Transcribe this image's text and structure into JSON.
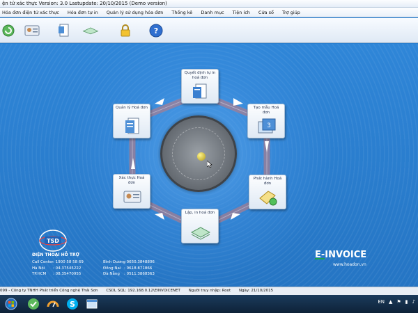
{
  "window": {
    "title": "ện tử xác thực Version: 3.0 Lastupdate: 20/10/2015 (Demo version)"
  },
  "menu": [
    "Hóa đơn điện tử xác thực",
    "Hóa đơn tự in",
    "Quản lý sử dụng hóa đơn",
    "Thống kê",
    "Danh mục",
    "Tiện ích",
    "Cửa sổ",
    "Trợ giúp"
  ],
  "toolbar": {
    "icons": [
      "refresh-icon",
      "id-card-icon",
      "document-icon",
      "paper-stack-icon",
      "lock-icon",
      "help-icon"
    ]
  },
  "workflow": {
    "nodes": [
      {
        "label": "Quyết định tự in hoá đơn",
        "icon": "decision-icon"
      },
      {
        "label": "Tạo mẫu Hoá đơn",
        "icon": "template-icon"
      },
      {
        "label": "Phát hành Hoá đơn",
        "icon": "publish-icon"
      },
      {
        "label": "Lập, in hoá đơn",
        "icon": "print-icon"
      },
      {
        "label": "Xác thực Hoá đơn",
        "icon": "verify-icon"
      },
      {
        "label": "Quản lý Hoá đơn",
        "icon": "manage-icon"
      }
    ]
  },
  "support": {
    "title": "ĐIỆN THOẠI HỖ TRỢ",
    "left": [
      {
        "k": "Call Center",
        "v": ": 1900 58 58 69"
      },
      {
        "k": "Hà Nội",
        "v": ": 04.37545222"
      },
      {
        "k": "TP.HCM",
        "v": ": 08.35470955"
      }
    ],
    "right": [
      {
        "k": "Bình Dương",
        "v": ": 0650.3848806"
      },
      {
        "k": "Đồng Nai",
        "v": ": 0618.871866"
      },
      {
        "k": "Đà Nẵng",
        "v": ": 0511.3868363"
      }
    ]
  },
  "brand": {
    "einvoice": "E-INVOICE",
    "url": "www.hoadon.vn",
    "accent": "#1aa34a"
  },
  "statusbar": {
    "parts": [
      "099 - Công ty TNHH Phát triển Công nghệ Thái Sơn",
      "CSDL SQL: 192.168.0.12\\EINVOICENET",
      "Người truy nhập: Root",
      "Ngày: 21/10/2015"
    ]
  },
  "taskbar": {
    "lang": "EN"
  }
}
